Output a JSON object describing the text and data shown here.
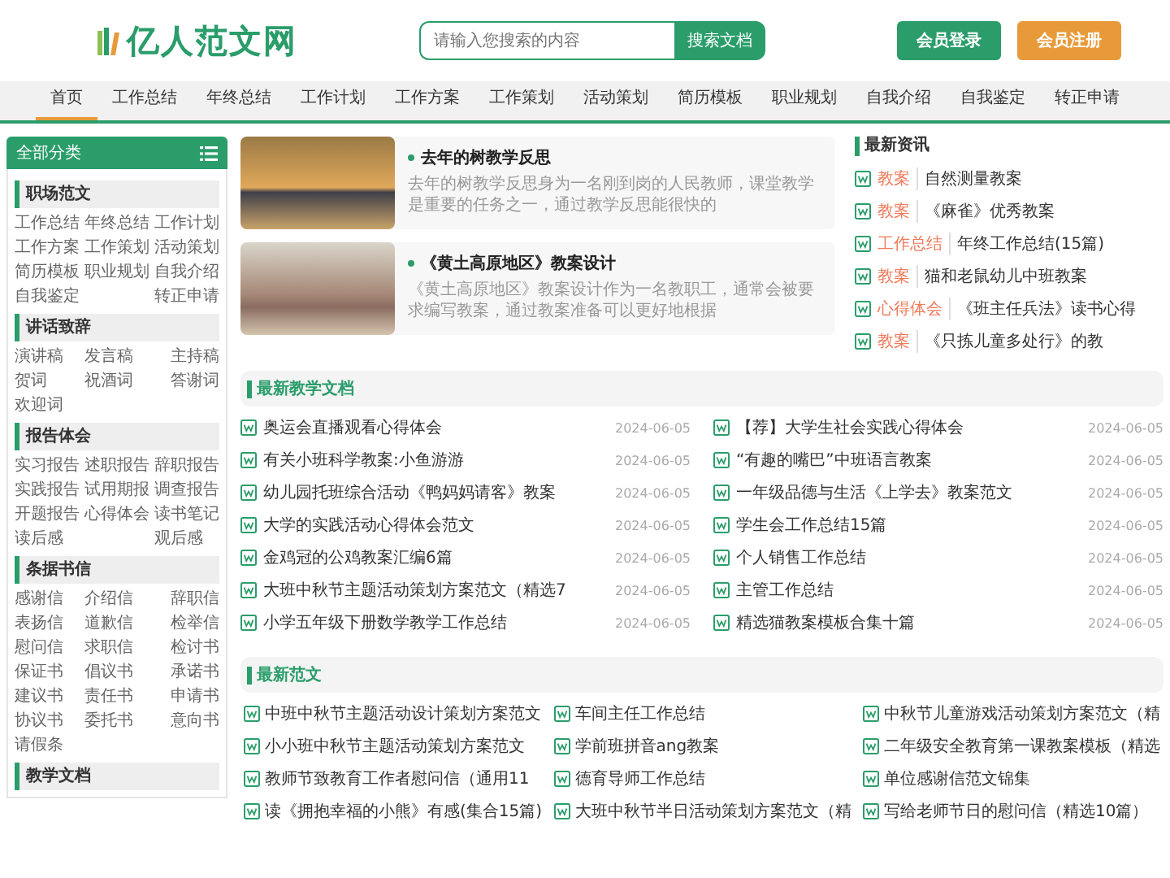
{
  "header": {
    "logo": "亿人范文网",
    "search": {
      "placeholder": "请输入您搜索的内容",
      "button": "搜索文档"
    },
    "buttons": [
      {
        "label": "会员登录",
        "kind": "login"
      },
      {
        "label": "会员注册",
        "kind": "register"
      }
    ]
  },
  "nav": [
    {
      "label": "首页",
      "selected": true
    },
    {
      "label": "工作总结",
      "selected": false
    },
    {
      "label": "年终总结",
      "selected": false
    },
    {
      "label": "工作计划",
      "selected": false
    },
    {
      "label": "工作方案",
      "selected": false
    },
    {
      "label": "工作策划",
      "selected": false
    },
    {
      "label": "活动策划",
      "selected": false
    },
    {
      "label": "简历模板",
      "selected": false
    },
    {
      "label": "职业规划",
      "selected": false
    },
    {
      "label": "自我介绍",
      "selected": false
    },
    {
      "label": "自我鉴定",
      "selected": false
    },
    {
      "label": "转正申请",
      "selected": false
    }
  ],
  "sidebar": {
    "title": "全部分类",
    "sections": [
      {
        "title": "职场范文",
        "links": [
          "工作总结",
          "年终总结",
          "工作计划",
          "工作方案",
          "工作策划",
          "活动策划",
          "简历模板",
          "职业规划",
          "自我介绍",
          "自我鉴定",
          "转正申请"
        ]
      },
      {
        "title": "讲话致辞",
        "links": [
          "演讲稿",
          "发言稿",
          "主持稿",
          "贺词",
          "祝酒词",
          "答谢词",
          "欢迎词"
        ]
      },
      {
        "title": "报告体会",
        "links": [
          "实习报告",
          "述职报告",
          "辞职报告",
          "实践报告",
          "试用期报",
          "调查报告",
          "开题报告",
          "心得体会",
          "读书笔记",
          "读后感",
          "观后感"
        ]
      },
      {
        "title": "条据书信",
        "links": [
          "感谢信",
          "介绍信",
          "辞职信",
          "表扬信",
          "道歉信",
          "检举信",
          "慰问信",
          "求职信",
          "检讨书",
          "保证书",
          "倡议书",
          "承诺书",
          "建议书",
          "责任书",
          "申请书",
          "协议书",
          "委托书",
          "意向书",
          "请假条"
        ]
      },
      {
        "title": "教学文档"
      }
    ]
  },
  "featured": [
    {
      "title": "去年的树教学反思",
      "summary": "去年的树教学反思身为一名刚到岗的人民教师，课堂教学是重要的任务之一，通过教学反思能很快的"
    },
    {
      "title": "《黄土高原地区》教案设计",
      "summary": "《黄土高原地区》教案设计作为一名教职工，通常会被要求编写教案，通过教案准备可以更好地根据"
    }
  ],
  "news": {
    "title": "最新资讯",
    "items": [
      {
        "tag": "教案",
        "title": "自然测量教案"
      },
      {
        "tag": "教案",
        "title": "《麻雀》优秀教案"
      },
      {
        "tag": "工作总结",
        "title": "年终工作总结(15篇)"
      },
      {
        "tag": "教案",
        "title": "猫和老鼠幼儿中班教案"
      },
      {
        "tag": "心得体会",
        "title": "《班主任兵法》读书心得"
      },
      {
        "tag": "教案",
        "title": "《只拣儿童多处行》的教"
      }
    ]
  },
  "teaching_docs": {
    "title": "最新教学文档",
    "items": [
      {
        "title": "奥运会直播观看心得体会",
        "date": "2024-06-05"
      },
      {
        "title": "【荐】大学生社会实践心得体会",
        "date": "2024-06-05"
      },
      {
        "title": "有关小班科学教案:小鱼游游",
        "date": "2024-06-05"
      },
      {
        "title": "“有趣的嘴巴”中班语言教案",
        "date": "2024-06-05"
      },
      {
        "title": "幼儿园托班综合活动《鸭妈妈请客》教案",
        "date": "2024-06-05"
      },
      {
        "title": "一年级品德与生活《上学去》教案范文",
        "date": "2024-06-05"
      },
      {
        "title": "大学的实践活动心得体会范文",
        "date": "2024-06-05"
      },
      {
        "title": "学生会工作总结15篇",
        "date": "2024-06-05"
      },
      {
        "title": "金鸡冠的公鸡教案汇编6篇",
        "date": "2024-06-05"
      },
      {
        "title": "个人销售工作总结",
        "date": "2024-06-05"
      },
      {
        "title": "大班中秋节主题活动策划方案范文（精选7",
        "date": "2024-06-05"
      },
      {
        "title": "主管工作总结",
        "date": "2024-06-05"
      },
      {
        "title": "小学五年级下册数学教学工作总结",
        "date": "2024-06-05"
      },
      {
        "title": "精选猫教案模板合集十篇",
        "date": "2024-06-05"
      }
    ]
  },
  "latest_essays": {
    "title": "最新范文",
    "items": [
      "中班中秋节主题活动设计策划方案范文",
      "车间主任工作总结",
      "中秋节儿童游戏活动策划方案范文（精",
      "小小班中秋节主题活动策划方案范文",
      "学前班拼音ang教案",
      "二年级安全教育第一课教案模板（精选",
      "教师节致教育工作者慰问信（通用11",
      "德育导师工作总结",
      "单位感谢信范文锦集",
      "读《拥抱幸福的小熊》有感(集合15篇)",
      "大班中秋节半日活动策划方案范文（精",
      "写给老师节日的慰问信（精选10篇）"
    ]
  }
}
